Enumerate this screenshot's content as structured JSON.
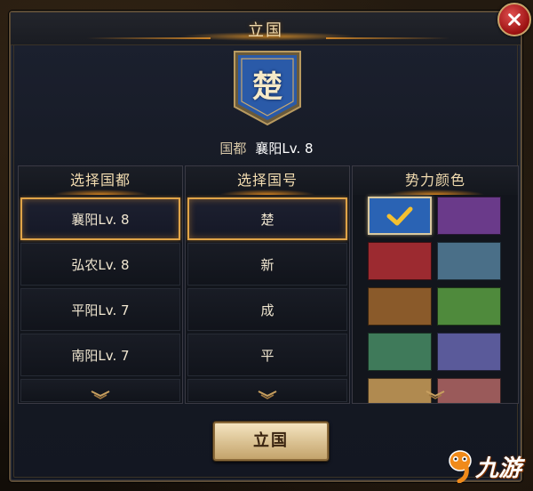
{
  "dialog": {
    "title": "立国"
  },
  "banner": {
    "char": "楚",
    "color": "#2a5aa8"
  },
  "capital": {
    "label": "国都",
    "value": "襄阳Lv. 8"
  },
  "capital_column": {
    "header": "选择国都",
    "items": [
      {
        "label": "襄阳Lv. 8",
        "selected": true
      },
      {
        "label": "弘农Lv. 8",
        "selected": false
      },
      {
        "label": "平阳Lv. 7",
        "selected": false
      },
      {
        "label": "南阳Lv. 7",
        "selected": false
      }
    ]
  },
  "name_column": {
    "header": "选择国号",
    "items": [
      {
        "label": "楚",
        "selected": true
      },
      {
        "label": "新",
        "selected": false
      },
      {
        "label": "成",
        "selected": false
      },
      {
        "label": "平",
        "selected": false
      }
    ]
  },
  "color_column": {
    "header": "势力颜色",
    "swatches": [
      {
        "color": "#2a63b4",
        "selected": true
      },
      {
        "color": "#6a3a8a",
        "selected": false
      },
      {
        "color": "#9c2a30",
        "selected": false
      },
      {
        "color": "#4a6f88",
        "selected": false
      },
      {
        "color": "#8a5a2a",
        "selected": false
      },
      {
        "color": "#4f8a3c",
        "selected": false
      },
      {
        "color": "#3f7a5a",
        "selected": false
      },
      {
        "color": "#5a5a9a",
        "selected": false
      },
      {
        "color": "#b08a50",
        "selected": false
      },
      {
        "color": "#9a5a5a",
        "selected": false
      }
    ]
  },
  "confirm_button": {
    "label": "立国"
  },
  "watermark": {
    "text": "九游"
  },
  "icons": {
    "close": "close-icon",
    "check": "check-icon",
    "scroll_more": "chevron-down-icon"
  },
  "accent_colors": {
    "gold": "#e0a448",
    "title_text": "#f3dcae",
    "close_red": "#c02020"
  }
}
